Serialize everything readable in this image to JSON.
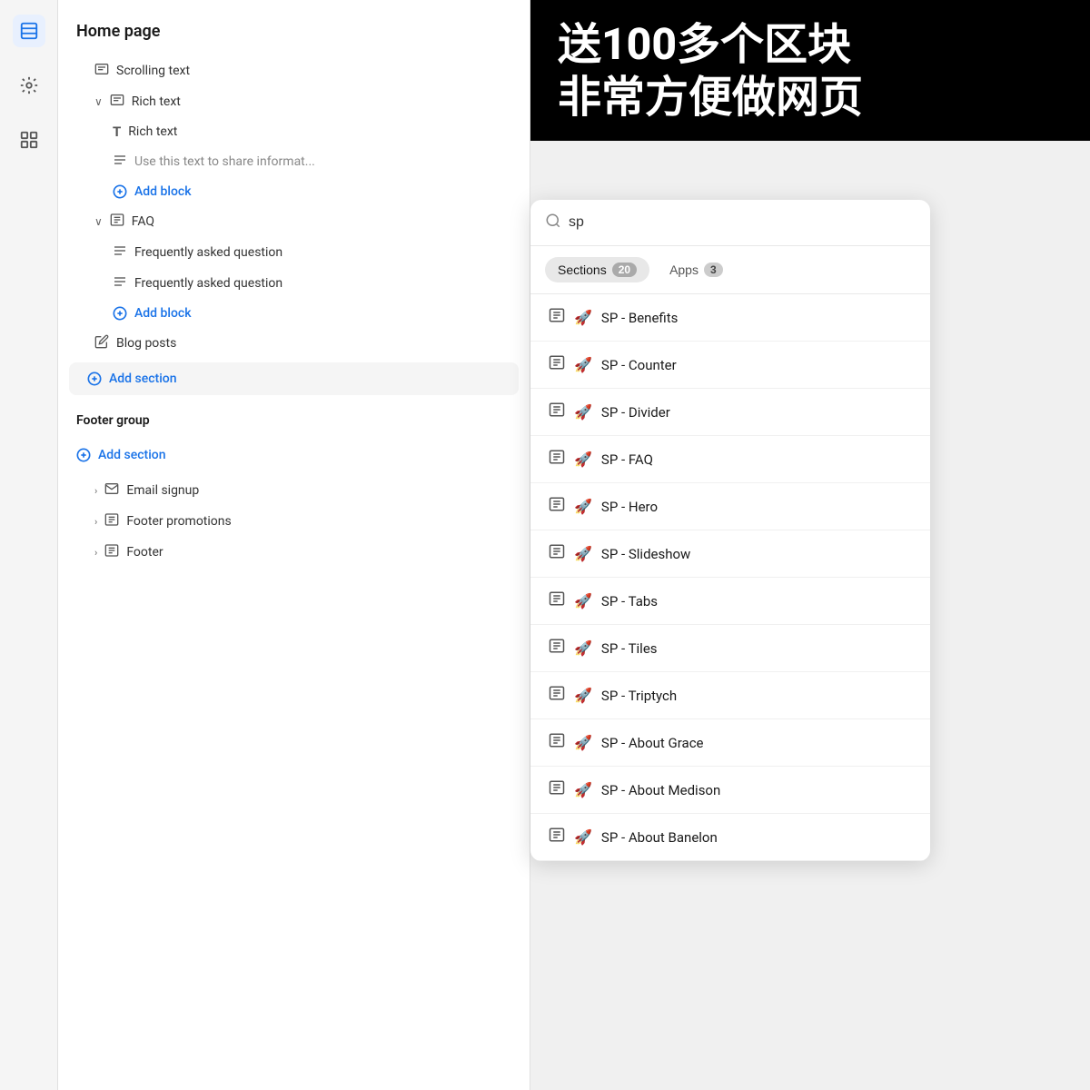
{
  "sidebar": {
    "icons": [
      {
        "name": "layers-icon",
        "symbol": "⊟",
        "active": true
      },
      {
        "name": "settings-icon",
        "symbol": "⚙"
      },
      {
        "name": "apps-icon",
        "symbol": "⊞"
      }
    ]
  },
  "left_panel": {
    "page_title": "Home page",
    "tree_items": [
      {
        "id": "scrolling-text",
        "label": "Scrolling text",
        "icon": "▤",
        "indent": 1,
        "type": "item"
      },
      {
        "id": "rich-text-parent",
        "label": "Rich text",
        "icon": "▤",
        "indent": 1,
        "type": "expanded",
        "chevron": "∨"
      },
      {
        "id": "rich-text-child-t",
        "label": "Rich text",
        "icon": "T",
        "indent": 2,
        "type": "item"
      },
      {
        "id": "rich-text-desc",
        "label": "Use this text to share informat...",
        "icon": "≡",
        "indent": 2,
        "type": "item"
      },
      {
        "id": "add-block-rich",
        "label": "Add block",
        "indent": 2,
        "type": "add-block"
      },
      {
        "id": "faq-parent",
        "label": "FAQ",
        "icon": "⊟",
        "indent": 1,
        "type": "expanded",
        "chevron": "∨"
      },
      {
        "id": "faq-q1",
        "label": "Frequently asked question",
        "icon": "≡",
        "indent": 2,
        "type": "item"
      },
      {
        "id": "faq-q2",
        "label": "Frequently asked question",
        "icon": "≡",
        "indent": 2,
        "type": "item"
      },
      {
        "id": "add-block-faq",
        "label": "Add block",
        "indent": 2,
        "type": "add-block"
      },
      {
        "id": "blog-posts",
        "label": "Blog posts",
        "icon": "✎",
        "indent": 1,
        "type": "item"
      },
      {
        "id": "add-section-home",
        "label": "Add section",
        "type": "add-section"
      }
    ],
    "footer_group_title": "Footer group",
    "footer_items": [
      {
        "id": "add-section-footer",
        "label": "Add section",
        "type": "add-section"
      },
      {
        "id": "email-signup",
        "label": "Email signup",
        "icon": "✉",
        "indent": 1,
        "type": "collapsible",
        "chevron": ">"
      },
      {
        "id": "footer-promotions",
        "label": "Footer promotions",
        "icon": "⊟",
        "indent": 1,
        "type": "collapsible",
        "chevron": ">"
      },
      {
        "id": "footer",
        "label": "Footer",
        "icon": "⊟",
        "indent": 1,
        "type": "collapsible",
        "chevron": ">"
      }
    ]
  },
  "search_panel": {
    "search_value": "sp",
    "search_placeholder": "Search",
    "tabs": [
      {
        "id": "sections",
        "label": "Sections",
        "count": "20",
        "active": true
      },
      {
        "id": "apps",
        "label": "Apps",
        "count": "3",
        "active": false
      }
    ],
    "results": [
      {
        "id": "sp-benefits",
        "label": "SP - Benefits",
        "section_icon": "⊟",
        "emoji": "🚀"
      },
      {
        "id": "sp-counter",
        "label": "SP - Counter",
        "section_icon": "⊟",
        "emoji": "🚀"
      },
      {
        "id": "sp-divider",
        "label": "SP - Divider",
        "section_icon": "⊟",
        "emoji": "🚀"
      },
      {
        "id": "sp-faq",
        "label": "SP - FAQ",
        "section_icon": "⊟",
        "emoji": "🚀"
      },
      {
        "id": "sp-hero",
        "label": "SP - Hero",
        "section_icon": "⊟",
        "emoji": "🚀"
      },
      {
        "id": "sp-slideshow",
        "label": "SP - Slideshow",
        "section_icon": "⊟",
        "emoji": "🚀"
      },
      {
        "id": "sp-tabs",
        "label": "SP - Tabs",
        "section_icon": "⊟",
        "emoji": "🚀"
      },
      {
        "id": "sp-tiles",
        "label": "SP - Tiles",
        "section_icon": "⊟",
        "emoji": "🚀"
      },
      {
        "id": "sp-triptych",
        "label": "SP - Triptych",
        "section_icon": "⊟",
        "emoji": "🚀"
      },
      {
        "id": "sp-about-grace",
        "label": "SP - About Grace",
        "section_icon": "⊟",
        "emoji": "🚀"
      },
      {
        "id": "sp-about-medison",
        "label": "SP - About Medison",
        "section_icon": "⊟",
        "emoji": "🚀"
      },
      {
        "id": "sp-about-banelon",
        "label": "SP - About Banelon",
        "section_icon": "⊟",
        "emoji": "🚀"
      }
    ]
  },
  "banner": {
    "line1": "送100多个区块",
    "line2": "非常方便做网页"
  },
  "colors": {
    "blue": "#1a73e8",
    "black": "#000000",
    "white": "#ffffff"
  }
}
